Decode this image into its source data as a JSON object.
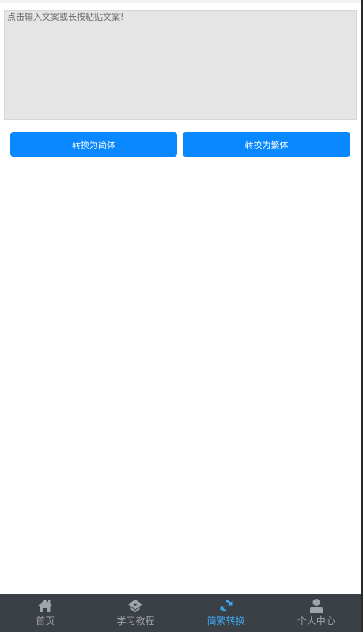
{
  "editor": {
    "placeholder": "点击输入文案或长按粘贴文案!",
    "value": ""
  },
  "actions": {
    "to_simplified": "转换为简体",
    "to_traditional": "转换为繁体"
  },
  "tabbar": {
    "items": [
      {
        "label": "首页",
        "icon": "home-icon",
        "active": false
      },
      {
        "label": "学习教程",
        "icon": "tutorial-icon",
        "active": false
      },
      {
        "label": "简繁转换",
        "icon": "convert-icon",
        "active": true
      },
      {
        "label": "个人中心",
        "icon": "user-icon",
        "active": false
      }
    ],
    "active_color": "#3eaaf5",
    "inactive_color": "#a0a4ab",
    "background": "#3b3f46"
  },
  "colors": {
    "button": "#0a88ff",
    "editor_bg": "#e5e5e5"
  }
}
